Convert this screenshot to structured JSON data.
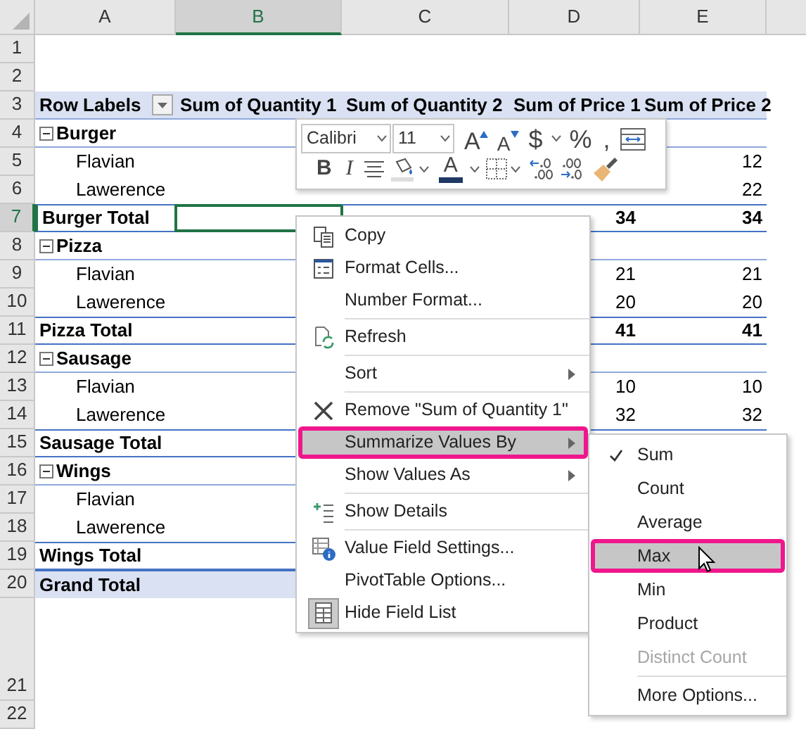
{
  "columns": [
    {
      "letter": "A",
      "selected": false
    },
    {
      "letter": "B",
      "selected": true
    },
    {
      "letter": "C",
      "selected": false
    },
    {
      "letter": "D",
      "selected": false
    },
    {
      "letter": "E",
      "selected": false
    }
  ],
  "rows": [
    {
      "number": "1",
      "kind": "blank",
      "selected": false
    },
    {
      "number": "2",
      "kind": "blank",
      "selected": false
    },
    {
      "number": "3",
      "kind": "header",
      "selected": false,
      "label": "Row Labels",
      "values": {
        "B": "Sum of Quantity 1",
        "C": "Sum of Quantity 2",
        "D": "Sum of Price 1",
        "E": "Sum of Price 2"
      }
    },
    {
      "number": "4",
      "kind": "group",
      "selected": false,
      "label": "Burger"
    },
    {
      "number": "5",
      "kind": "item",
      "selected": false,
      "label": "Flavian",
      "values": {
        "E": "12"
      }
    },
    {
      "number": "6",
      "kind": "item",
      "selected": false,
      "label": "Lawerence",
      "values": {
        "E": "22"
      }
    },
    {
      "number": "7",
      "kind": "subtotal",
      "selected": true,
      "label": "Burger Total",
      "values": {
        "D": "34",
        "E": "34"
      }
    },
    {
      "number": "8",
      "kind": "group",
      "selected": false,
      "label": "Pizza"
    },
    {
      "number": "9",
      "kind": "item",
      "selected": false,
      "label": "Flavian",
      "values": {
        "D": "21",
        "E": "21"
      }
    },
    {
      "number": "10",
      "kind": "item",
      "selected": false,
      "label": "Lawerence",
      "values": {
        "D": "20",
        "E": "20"
      }
    },
    {
      "number": "11",
      "kind": "subtotal",
      "selected": false,
      "label": "Pizza Total",
      "values": {
        "D": "41",
        "E": "41"
      }
    },
    {
      "number": "12",
      "kind": "group",
      "selected": false,
      "label": "Sausage"
    },
    {
      "number": "13",
      "kind": "item",
      "selected": false,
      "label": "Flavian",
      "values": {
        "D": "10",
        "E": "10"
      }
    },
    {
      "number": "14",
      "kind": "item",
      "selected": false,
      "label": "Lawerence",
      "values": {
        "D": "32",
        "E": "32"
      }
    },
    {
      "number": "15",
      "kind": "subtotal",
      "selected": false,
      "label": "Sausage Total"
    },
    {
      "number": "16",
      "kind": "group",
      "selected": false,
      "label": "Wings"
    },
    {
      "number": "17",
      "kind": "item",
      "selected": false,
      "label": "Flavian"
    },
    {
      "number": "18",
      "kind": "item",
      "selected": false,
      "label": "Lawerence"
    },
    {
      "number": "19",
      "kind": "subtotal",
      "selected": false,
      "label": "Wings Total"
    },
    {
      "number": "20",
      "kind": "grand",
      "selected": false,
      "label": "Grand Total"
    },
    {
      "number": "21",
      "kind": "blank",
      "selected": false
    },
    {
      "number": "22",
      "kind": "blank",
      "selected": false
    }
  ],
  "mini_toolbar": {
    "font": "Calibri",
    "size": "11",
    "row_1": [
      {
        "kind": "grow_font",
        "label": "A"
      },
      {
        "kind": "shrink_font",
        "label": "A"
      },
      {
        "kind": "text",
        "label": "$",
        "dropdown": true
      },
      {
        "kind": "text",
        "label": "%"
      },
      {
        "kind": "text",
        "label": ","
      },
      {
        "kind": "wrap"
      }
    ],
    "row_2": [
      {
        "kind": "bold",
        "label": "B"
      },
      {
        "kind": "italic",
        "label": "I"
      },
      {
        "kind": "align"
      },
      {
        "kind": "fill",
        "dropdown": true
      },
      {
        "kind": "font_color",
        "label": "A",
        "dropdown": true
      },
      {
        "kind": "borders",
        "dropdown": true
      },
      {
        "kind": "increase_decimal"
      },
      {
        "kind": "decrease_decimal"
      },
      {
        "kind": "painter"
      }
    ]
  },
  "context_menu": [
    {
      "label": "Copy",
      "kind": "copy",
      "submenu": false,
      "selected": false,
      "separator_after": false
    },
    {
      "label": "Format Cells...",
      "kind": "format",
      "submenu": false,
      "selected": false,
      "separator_after": false
    },
    {
      "label": "Number Format...",
      "kind": "plain",
      "submenu": false,
      "selected": false,
      "separator_after": true
    },
    {
      "label": "Refresh",
      "kind": "refresh",
      "submenu": false,
      "selected": false,
      "separator_after": true
    },
    {
      "label": "Sort",
      "kind": "plain",
      "submenu": true,
      "selected": false,
      "separator_after": true
    },
    {
      "label": "Remove \"Sum of Quantity 1\"",
      "kind": "remove",
      "submenu": false,
      "selected": false,
      "separator_after": false
    },
    {
      "label": "Summarize Values By",
      "kind": "plain",
      "submenu": true,
      "selected": true,
      "separator_after": false
    },
    {
      "label": "Show Values As",
      "kind": "plain",
      "submenu": true,
      "selected": false,
      "separator_after": true
    },
    {
      "label": "Show Details",
      "kind": "details",
      "submenu": false,
      "selected": false,
      "separator_after": true
    },
    {
      "label": "Value Field Settings...",
      "kind": "settings",
      "submenu": false,
      "selected": false,
      "separator_after": false
    },
    {
      "label": "PivotTable Options...",
      "kind": "plain",
      "submenu": false,
      "selected": false,
      "separator_after": false
    },
    {
      "label": "Hide Field List",
      "kind": "fieldlist",
      "submenu": false,
      "selected": false,
      "separator_after": false
    }
  ],
  "submenu": [
    {
      "label": "Sum",
      "checked": true,
      "selected": false,
      "disabled": false,
      "separator_before": false
    },
    {
      "label": "Count",
      "checked": false,
      "selected": false,
      "disabled": false,
      "separator_before": false
    },
    {
      "label": "Average",
      "checked": false,
      "selected": false,
      "disabled": false,
      "separator_before": false
    },
    {
      "label": "Max",
      "checked": false,
      "selected": true,
      "disabled": false,
      "separator_before": false
    },
    {
      "label": "Min",
      "checked": false,
      "selected": false,
      "disabled": false,
      "separator_before": false
    },
    {
      "label": "Product",
      "checked": false,
      "selected": false,
      "disabled": false,
      "separator_before": false
    },
    {
      "label": "Distinct Count",
      "checked": false,
      "selected": false,
      "disabled": true,
      "separator_before": false
    },
    {
      "label": "More Options...",
      "checked": false,
      "selected": false,
      "disabled": false,
      "separator_before": true
    }
  ]
}
